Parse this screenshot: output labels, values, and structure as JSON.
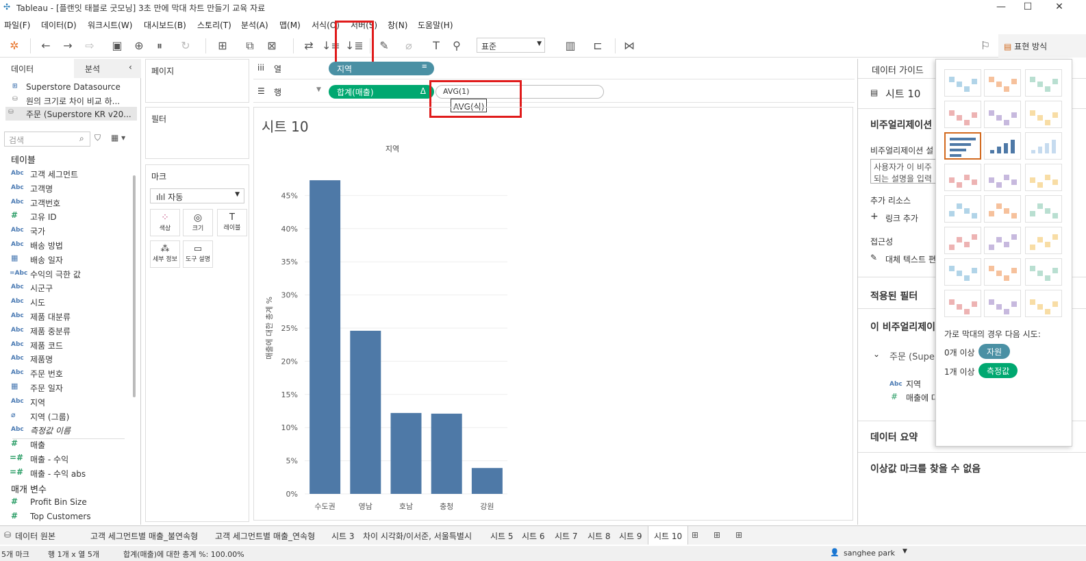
{
  "window": {
    "title": "Tableau - [플랜잇 태블로 굿모닝] 3초 만에 막대 차트 만들기 교육 자료",
    "min": "—",
    "max": "☐",
    "close": "✕"
  },
  "menu": [
    "파일(F)",
    "데이터(D)",
    "워크시트(W)",
    "대시보드(B)",
    "스토리(T)",
    "분석(A)",
    "맵(M)",
    "서식(O)",
    "서버(S)",
    "창(N)",
    "도움말(H)"
  ],
  "toolbar": {
    "standard": "표준",
    "format_btn": "표현 방식"
  },
  "left": {
    "tab_data": "데이터",
    "tab_analysis": "분석",
    "sources": [
      "Superstore Datasource",
      "원의 크기로 차이 비교 하...",
      "주문 (Superstore KR v20..."
    ],
    "search_placeholder": "검색",
    "tables_label": "테이블",
    "fields": [
      {
        "t": "Abc",
        "n": "고객 세그먼트"
      },
      {
        "t": "Abc",
        "n": "고객명"
      },
      {
        "t": "Abc",
        "n": "고객번호"
      },
      {
        "t": "#",
        "n": "고유 ID"
      },
      {
        "t": "Abc",
        "n": "국가"
      },
      {
        "t": "Abc",
        "n": "배송 방법"
      },
      {
        "t": "cal",
        "n": "배송 일자"
      },
      {
        "t": "=Abc",
        "n": "수익의 극한 값"
      },
      {
        "t": "Abc",
        "n": "시군구"
      },
      {
        "t": "Abc",
        "n": "시도"
      },
      {
        "t": "Abc",
        "n": "제품 대분류"
      },
      {
        "t": "Abc",
        "n": "제품 중분류"
      },
      {
        "t": "Abc",
        "n": "제품 코드"
      },
      {
        "t": "Abc",
        "n": "제품명"
      },
      {
        "t": "Abc",
        "n": "주문 번호"
      },
      {
        "t": "cal",
        "n": "주문 일자"
      },
      {
        "t": "Abc",
        "n": "지역"
      },
      {
        "t": "clip",
        "n": "지역 (그룹)"
      },
      {
        "t": "Abc",
        "n": "측정값 이름"
      },
      {
        "t": "#",
        "n": "매출"
      },
      {
        "t": "=#",
        "n": "매출 - 수익"
      },
      {
        "t": "=#",
        "n": "매출 - 수익 abs"
      }
    ],
    "params_label": "매개 변수",
    "params": [
      "Profit Bin Size",
      "Top Customers"
    ]
  },
  "shelves": {
    "pages": "페이지",
    "filters": "필터",
    "marks": "마크",
    "marks_type": "자동",
    "mark_buttons": [
      "색상",
      "크기",
      "레이블",
      "세부 정보",
      "도구 설명"
    ],
    "columns_label": "열",
    "rows_label": "행",
    "columns_pill": "지역",
    "rows_pill": "합계(매출)",
    "rows_pill_delta": "Δ",
    "calc_text": "AVG(1)",
    "tooltip": "AVG(식)"
  },
  "sheet": {
    "title": "시트 10"
  },
  "chart_data": {
    "type": "bar",
    "title": "지역",
    "ylabel": "매출에 대한 총계 %",
    "categories": [
      "수도권",
      "영남",
      "호남",
      "충청",
      "강원"
    ],
    "values": [
      47.3,
      24.6,
      12.2,
      12.1,
      3.9
    ],
    "yticks": [
      "0%",
      "5%",
      "10%",
      "15%",
      "20%",
      "25%",
      "30%",
      "35%",
      "40%",
      "45%"
    ],
    "ylim": [
      0,
      50
    ],
    "color": "#4e79a7"
  },
  "right": {
    "guide": "데이터 가이드",
    "sheet": "시트 10",
    "viz_desc": "비주얼리제이션",
    "viz_desc_label": "비주얼리제이션 설",
    "desc_placeholder_1": "사용자가 이 비주",
    "desc_placeholder_2": "되는 설명을 입력",
    "resources": "추가 리소스",
    "add_link": "링크 추가",
    "accessibility": "접근성",
    "alt_text": "대체 텍스트 편",
    "applied_filters": "적용된 필터",
    "this_viz": "이 비주얼리제이",
    "source": "주문 (Supe",
    "field1": "지역",
    "field2": "매출에 대",
    "summary": "데이터 요약",
    "no_outliers": "이상값 마크를 찾을 수 없음"
  },
  "showme": {
    "hint": "가로 막대의 경우 다음 시도:",
    "dim_count": "0개 이상",
    "dim": "자원",
    "meas_count": "1개 이상",
    "meas": "측정값"
  },
  "sheettabs": [
    "데이터 원본",
    "고객 세그먼트별 매출_불연속형",
    "고객 세그먼트별 매출_연속형",
    "시트 3",
    "차이 시각화/이서준, 서울특별시",
    "시트 5",
    "시트 6",
    "시트 7",
    "시트 8",
    "시트 9",
    "시트 10"
  ],
  "status": {
    "marks": "5개 마크",
    "rows": "행 1개 x 열 5개",
    "sum": "합계(매출)에 대한 총계 %: 100.00%",
    "user": "sanghee park"
  }
}
